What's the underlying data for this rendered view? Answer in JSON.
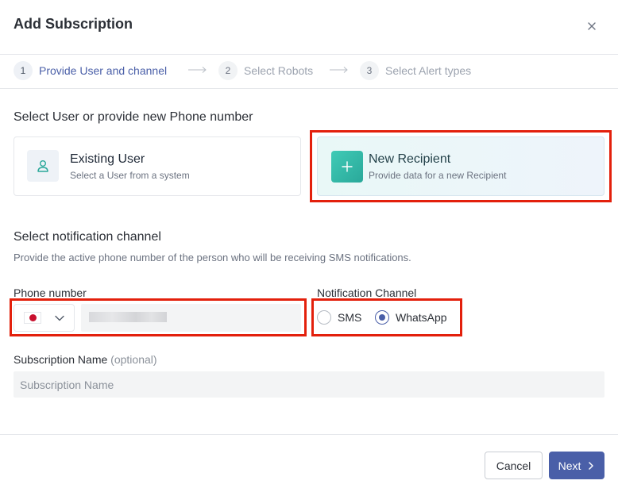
{
  "dialog": {
    "title": "Add Subscription",
    "close_icon": "close-icon"
  },
  "steps": [
    {
      "number": "1",
      "label": "Provide User and channel",
      "active": true
    },
    {
      "number": "2",
      "label": "Select Robots",
      "active": false
    },
    {
      "number": "3",
      "label": "Select Alert types",
      "active": false
    }
  ],
  "recipient": {
    "section_title": "Select User or provide new Phone number",
    "existing": {
      "title": "Existing User",
      "subtitle": "Select a User from a system",
      "icon": "user-icon"
    },
    "new": {
      "title": "New Recipient",
      "subtitle": "Provide data for a new Recipient",
      "icon": "plus-icon",
      "selected": true
    }
  },
  "channel": {
    "section_title": "Select notification channel",
    "description": "Provide the active phone number of the person who will be receiving SMS notifications.",
    "phone_label": "Phone number",
    "country_flag": "japan-flag-icon",
    "notification_label": "Notification Channel",
    "options": [
      {
        "label": "SMS",
        "checked": false
      },
      {
        "label": "WhatsApp",
        "checked": true
      }
    ]
  },
  "subscription": {
    "label": "Subscription Name",
    "optional": "(optional)",
    "placeholder": "Subscription Name",
    "value": ""
  },
  "footer": {
    "cancel_label": "Cancel",
    "next_label": "Next"
  },
  "colors": {
    "accent": "#4a5fa8",
    "highlight": "#e3200c",
    "teal": "#2aa89a"
  }
}
